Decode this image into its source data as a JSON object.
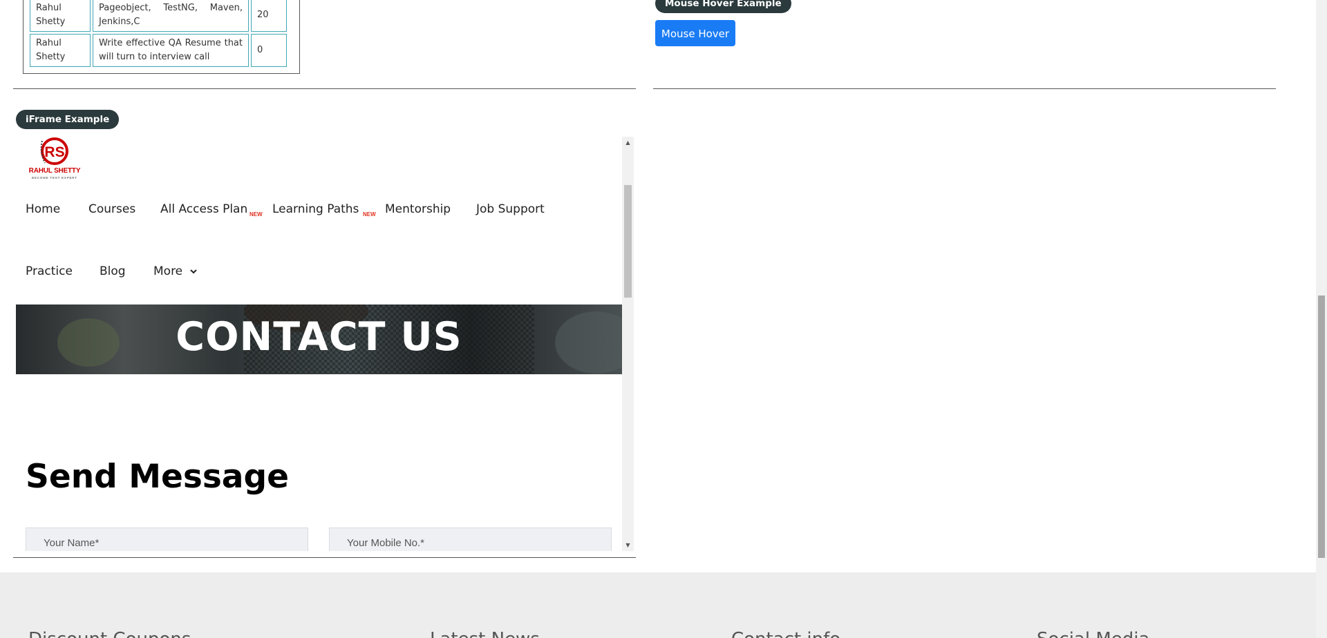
{
  "table": {
    "rows": [
      {
        "instructor": "Rahul Shetty",
        "course": "Pageobject, TestNG, Maven, Jenkins,C",
        "price": "20"
      },
      {
        "instructor": "Rahul Shetty",
        "course": "Write effective QA Resume that will turn to interview call",
        "price": "0"
      }
    ]
  },
  "mouse_hover": {
    "legend": "Mouse Hover Example",
    "button_label": "Mouse Hover"
  },
  "iframe": {
    "legend": "iFrame Example",
    "logo_text": "RAHUL SHETTY",
    "logo_sub": "BECOME TEST EXPERT",
    "nav": {
      "home": "Home",
      "courses": "Courses",
      "all_access": "All Access Plan",
      "new_badge": "NEW",
      "learning_paths": "Learning Paths",
      "mentorship": "Mentorship",
      "job_support": "Job Support",
      "practice": "Practice",
      "blog": "Blog",
      "more": "More"
    },
    "banner_title": "CONTACT US",
    "send_message": "Send Message",
    "name_placeholder": "Your Name*",
    "mobile_placeholder": "Your Mobile No.*"
  },
  "footer": {
    "headings": [
      "Discount Coupons",
      "Latest News",
      "Contact info",
      "Social Media"
    ]
  },
  "colors": {
    "accent": "#1a7cf5",
    "pill": "#2b3a3c",
    "table_border": "#3fa7b5",
    "brand_red": "#cc0000"
  },
  "icons": {
    "more": "chevron-down-icon",
    "scroll_up": "arrow-up-icon",
    "scroll_down": "arrow-down-icon"
  }
}
